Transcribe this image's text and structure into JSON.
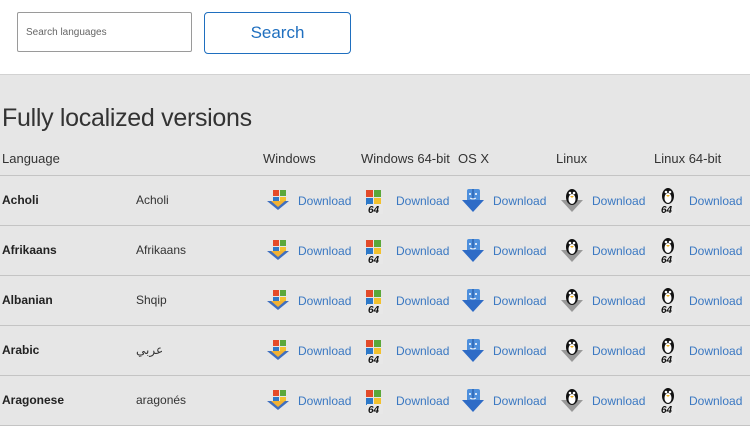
{
  "search": {
    "placeholder": "Search languages",
    "button_label": "Search"
  },
  "section_title": "Fully localized versions",
  "columns": {
    "language": "Language",
    "windows": "Windows",
    "windows64": "Windows 64-bit",
    "osx": "OS X",
    "linux": "Linux",
    "linux64": "Linux 64-bit"
  },
  "download_label": "Download",
  "badge_64": "64",
  "icons": {
    "windows": "windows-icon",
    "windows64": "windows-64-icon",
    "osx": "mac-finder-icon",
    "linux": "linux-tux-icon",
    "linux64": "linux-tux-64-icon"
  },
  "colors": {
    "link": "#3a78c2",
    "button": "#1f6fbf",
    "background": "#e6e6e6"
  },
  "rows": [
    {
      "name": "Acholi",
      "native": "Acholi"
    },
    {
      "name": "Afrikaans",
      "native": "Afrikaans"
    },
    {
      "name": "Albanian",
      "native": "Shqip"
    },
    {
      "name": "Arabic",
      "native": "عربي"
    },
    {
      "name": "Aragonese",
      "native": "aragonés"
    }
  ]
}
